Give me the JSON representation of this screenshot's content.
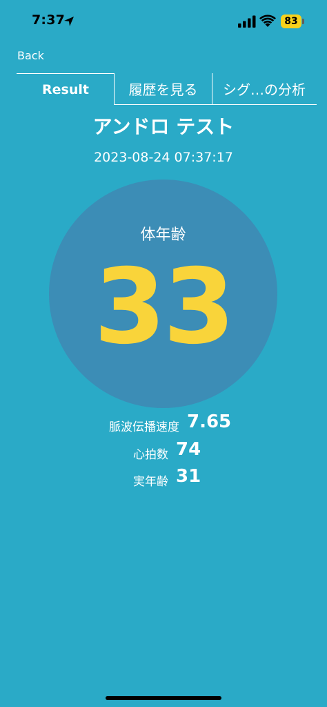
{
  "status_bar": {
    "time": "7:37",
    "battery": "83",
    "icons": [
      "location-arrow-icon",
      "cellular-signal-icon",
      "wifi-icon",
      "battery-icon"
    ]
  },
  "nav": {
    "back_label": "Back"
  },
  "tabs": [
    {
      "label": "Result",
      "active": true
    },
    {
      "label": "履歴を見る",
      "active": false
    },
    {
      "label": "シグ…の分析",
      "active": false
    }
  ],
  "header": {
    "title": "アンドロ テスト",
    "timestamp": "2023-08-24 07:37:17"
  },
  "result": {
    "label": "体年齢",
    "value": "33"
  },
  "metrics": [
    {
      "label": "脈波伝播速度",
      "value": "7.65"
    },
    {
      "label": "心拍数",
      "value": "74"
    },
    {
      "label": "実年齢",
      "value": "31"
    }
  ],
  "colors": {
    "background": "#2aaac7",
    "circle": "#3c8db6",
    "accent": "#f9d43a",
    "battery": "#f7d21c"
  }
}
